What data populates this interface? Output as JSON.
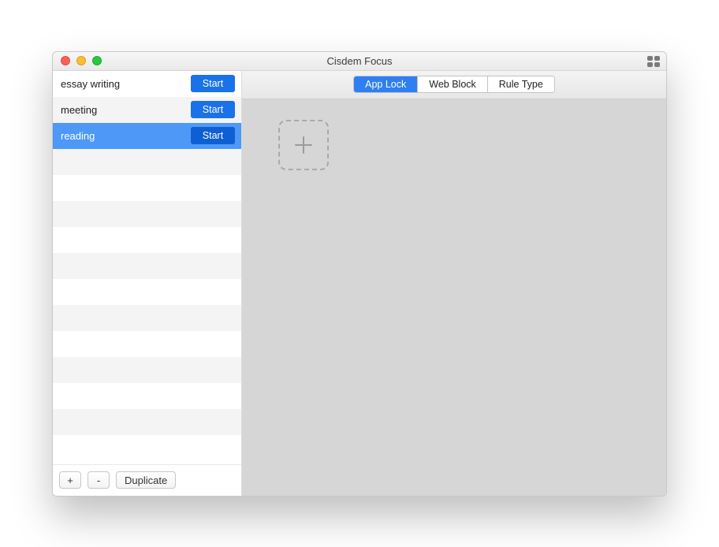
{
  "window": {
    "title": "Cisdem Focus"
  },
  "sidebar": {
    "start_label": "Start",
    "items": [
      {
        "label": "essay writing",
        "selected": false
      },
      {
        "label": "meeting",
        "selected": false
      },
      {
        "label": "reading",
        "selected": true
      }
    ],
    "footer": {
      "add": "+",
      "remove": "-",
      "duplicate": "Duplicate"
    }
  },
  "tabs": {
    "items": [
      {
        "label": "App Lock",
        "active": true
      },
      {
        "label": "Web Block",
        "active": false
      },
      {
        "label": "Rule Type",
        "active": false
      }
    ]
  },
  "main": {
    "add_app_tile": "Add"
  }
}
